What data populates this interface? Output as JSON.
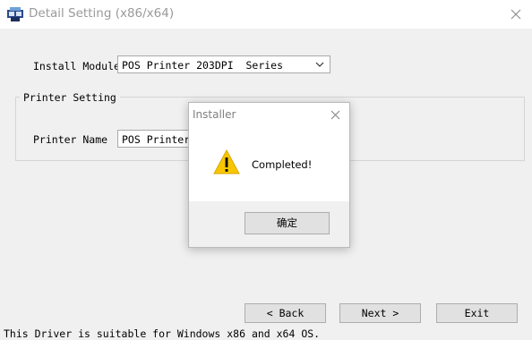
{
  "window": {
    "title": "Detail Setting (x86/x64)",
    "app_icon": "printer-app-icon",
    "close_icon": "close-icon"
  },
  "install_module": {
    "label": "Install Module",
    "selected": "POS Printer 203DPI  Series"
  },
  "printer_setting": {
    "group_label": "Printer Setting",
    "name_label": "Printer Name",
    "name_value": "POS Printer"
  },
  "buttons": {
    "back": "< Back",
    "next": "Next >",
    "exit": "Exit"
  },
  "footer_text": "This Driver is suitable for Windows x86 and x64 OS.",
  "dialog": {
    "title": "Installer",
    "message": "Completed!",
    "ok_label": "确定",
    "icon": "warning-icon"
  },
  "colors": {
    "client_bg": "#f0f0f0",
    "warning_yellow": "#f7c600"
  }
}
